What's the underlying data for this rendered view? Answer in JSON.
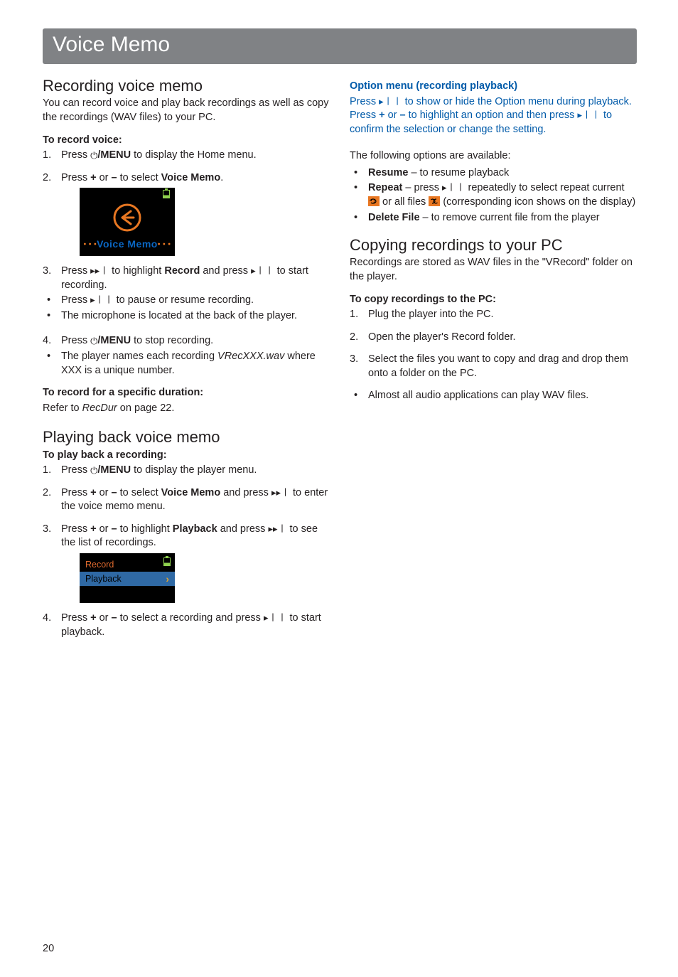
{
  "title_bar": "Voice Memo",
  "left": {
    "h_recording": "Recording voice memo",
    "intro_recording": "You can record voice and play back recordings as well as copy the recordings (WAV files) to your PC.",
    "to_record_voice": "To record voice:",
    "step1_a": "Press ",
    "step1_b": "/MENU",
    "step1_c": " to display the Home menu.",
    "step2_a": "Press ",
    "step2_plus": "+",
    "step2_or": " or ",
    "step2_minus": "–",
    "step2_b": " to select ",
    "step2_vm": "Voice Memo",
    "step2_end": ".",
    "home_label": "Voice Memo",
    "step3_a": "Press ",
    "step3_b": " to highlight ",
    "step3_rec": "Record",
    "step3_c": " and press ",
    "step3_d": " to start recording.",
    "bul_a1": "Press ",
    "bul_a2": " to pause or resume recording.",
    "bul_b": "The microphone is located at the back of the player.",
    "step4_a": "Press ",
    "step4_b": "/MENU",
    "step4_c": " to stop recording.",
    "bul_c1": "The player names each recording ",
    "bul_c_fname": "VRecXXX.wav",
    "bul_c2": " where XXX is a unique number.",
    "to_record_specific": "To record for a specific duration:",
    "refer_a": "Refer to ",
    "refer_em": "RecDur",
    "refer_b": " on page 22.",
    "h_playback": "Playing back voice memo",
    "to_play_back": "To play back a recording:",
    "pb1_a": "Press ",
    "pb1_b": "/MENU",
    "pb1_c": " to display the player menu.",
    "pb2_a": "Press ",
    "pb2_b": " to select ",
    "pb2_vm": "Voice Memo",
    "pb2_c": " and press ",
    "pb2_d": " to enter the voice memo menu.",
    "pb3_a": "Press ",
    "pb3_b": " to highlight ",
    "pb3_pb": "Playback",
    "pb3_c": " and press ",
    "pb3_d": " to see the list of recordings.",
    "list_record": "Record",
    "list_playback": "Playback",
    "pb4_a": "Press ",
    "pb4_b": " to select a recording and press ",
    "pb4_c": " to start playback."
  },
  "right": {
    "opt_title": "Option menu (recording playback)",
    "opt_p1a": "Press ",
    "opt_p1b": " to show or hide the Option menu during playback. Press ",
    "opt_p1c": " to highlight an option and then press ",
    "opt_p1d": " to confirm the selection or change the setting.",
    "plus": "+",
    "or": " or ",
    "minus": "–",
    "following": "The following options are available:",
    "resume_b": "Resume",
    "resume_t": " – to resume playback",
    "repeat_b": "Repeat",
    "repeat_t1": " – press ",
    "repeat_t2": " repeatedly to select repeat current ",
    "repeat_t3": " or all files ",
    "repeat_t4": "  (corresponding icon shows on the display)",
    "delete_b": "Delete File",
    "delete_t": " – to remove current file from the player",
    "h_copy": "Copying recordings to your PC",
    "copy_intro": "Recordings are stored as WAV files in the \"VRecord\" folder on the player.",
    "to_copy": "To copy recordings to the PC:",
    "c1": "Plug the player into the PC.",
    "c2": "Open the player's Record folder.",
    "c3": "Select the files you want to copy and drag and drop them onto a folder on the PC.",
    "c_bul": "Almost all audio applications can play WAV files."
  },
  "page_number": "20"
}
